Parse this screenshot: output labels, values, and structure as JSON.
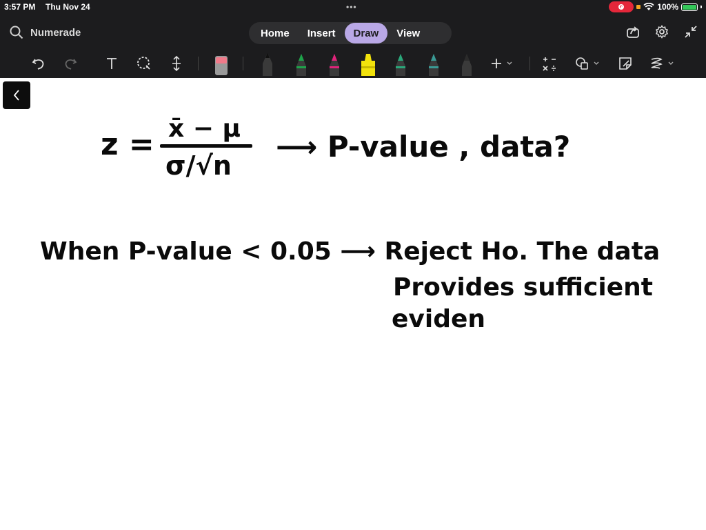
{
  "status_bar": {
    "time": "3:57 PM",
    "date": "Thu Nov 24",
    "battery": "100%"
  },
  "header": {
    "search_label": "Numerade",
    "tabs": [
      "Home",
      "Insert",
      "Draw",
      "View"
    ],
    "active_tab": "Draw"
  },
  "toolbar": {
    "pen_colors": [
      "#1c1c1e",
      "#1ea34a",
      "#e0237a",
      "#f2e20c",
      "#2aa77a",
      "#3a9a95",
      "#2b2b2b"
    ]
  },
  "canvas": {
    "formula_z": "z =",
    "formula_numerator": "x̄ − μ",
    "formula_denominator": "σ/√n",
    "formula_arrow_text": "⟶ P-value , data?",
    "line2": "When P-value < 0.05 ⟶ Reject Ho. The data",
    "line3": "Provides sufficient",
    "line4": "eviden"
  }
}
